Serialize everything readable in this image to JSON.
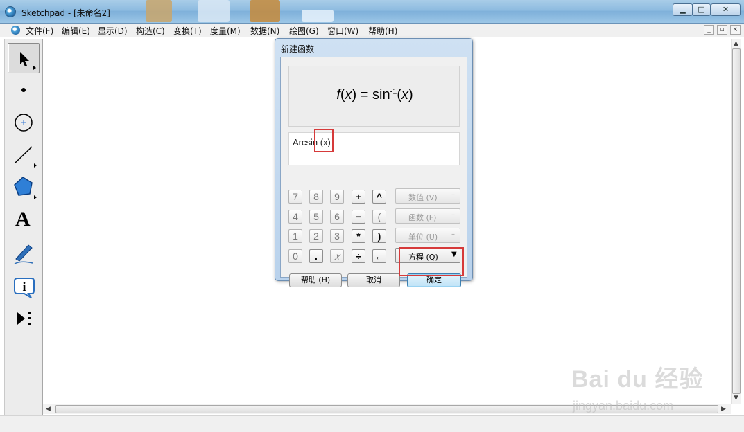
{
  "window": {
    "title": "Sketchpad  - [未命名2]",
    "minimize": "▁",
    "maximize": "□",
    "close": "✕"
  },
  "menu": [
    "文件(F)",
    "编辑(E)",
    "显示(D)",
    "构造(C)",
    "变换(T)",
    "度量(M)",
    "数据(N)",
    "绘图(G)",
    "窗口(W)",
    "帮助(H)"
  ],
  "toolbox": {
    "tools": [
      "selection-arrow",
      "point",
      "compass",
      "straightedge",
      "polygon",
      "text",
      "marker",
      "information",
      "custom-tools"
    ],
    "text_tool_glyph": "A"
  },
  "dialog": {
    "title": "新建函数",
    "preview": {
      "name": "f",
      "var": "x",
      "eq": " = sin",
      "sup": "-1",
      "arg": "x"
    },
    "expression": "Arcsin (x)",
    "keypad": [
      [
        "7",
        "8",
        "9",
        "+",
        "^"
      ],
      [
        "4",
        "5",
        "6",
        "−",
        "("
      ],
      [
        "1",
        "2",
        "3",
        "*",
        ")"
      ],
      [
        "0",
        ".",
        "𝑥",
        "÷",
        "←"
      ]
    ],
    "side_buttons": [
      "数值 (V)",
      "函数 (F)",
      "单位 (U)",
      "方程 (Q)"
    ],
    "help_button": "帮助 (H)",
    "cancel_button": "取消",
    "ok_button": "确定"
  },
  "watermark": {
    "logo": "Bai du 经验",
    "url": "jingyan.baidu.com"
  }
}
